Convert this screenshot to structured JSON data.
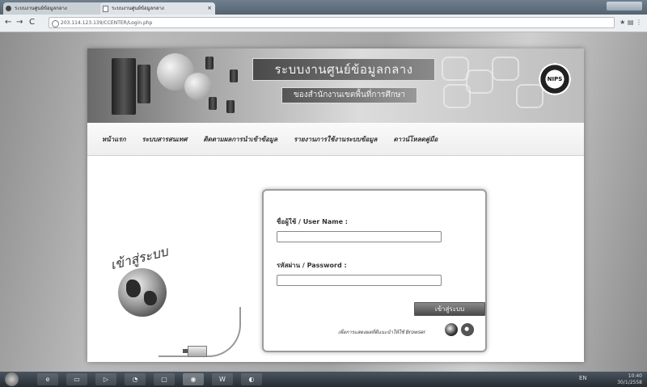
{
  "browser": {
    "tabs": [
      {
        "label": "ระบบงานศูนย์ข้อมูลกลาง"
      },
      {
        "label": "ระบบงานศูนย์ข้อมูลกลาง"
      }
    ],
    "url": "203.114.123.139/CCENTER/Login.php"
  },
  "banner": {
    "title": "ระบบงานศูนย์ข้อมูลกลาง",
    "subtitle": "ของสำนักงานเขตพื้นที่การศึกษา",
    "seal_text": "NIPS"
  },
  "menu": {
    "items": [
      {
        "label": "หน้าแรก"
      },
      {
        "label": "ระบบสารสนเทศ"
      },
      {
        "label": "ติดตามผลการนำเข้าข้อมูล"
      },
      {
        "label": "รายงานการใช้งานระบบข้อมูล"
      },
      {
        "label": "ดาวน์โหลดคู่มือ"
      }
    ]
  },
  "welcome": "เข้าสู่ระบบ",
  "login": {
    "username_label": "ชื่อผู้ใช้ / User Name :",
    "username_value": "",
    "password_label": "รหัสผ่าน / Password :",
    "password_value": "",
    "submit_label": "เข้าสู่ระบบ",
    "browser_hint": "เพื่อการแสดงผลที่ดีแนะนำให้ใช้ Browser"
  },
  "taskbar": {
    "lang": "EN",
    "time": "10:40",
    "date": "30/1/2558"
  },
  "colors": {
    "banner_dark": "#4a4a4a",
    "button": "#5a5a5a",
    "taskbar": "#262d33"
  }
}
